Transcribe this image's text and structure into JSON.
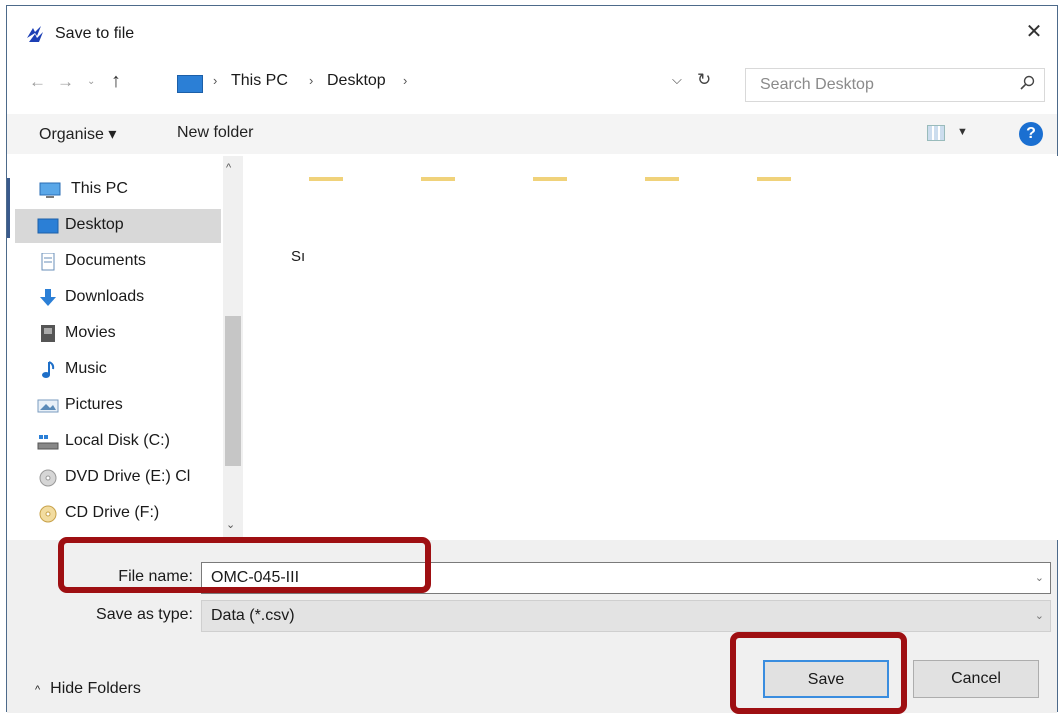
{
  "window": {
    "title": "Save to file",
    "close_symbol": "✕"
  },
  "nav": {
    "back": "←",
    "forward": "→",
    "recent": "⌄",
    "up": "↑"
  },
  "address": {
    "sep": "›",
    "crumbs": [
      "This PC",
      "Desktop"
    ],
    "dropdown": "⌵",
    "refresh": "↻"
  },
  "search": {
    "placeholder": "Search Desktop"
  },
  "toolbar": {
    "organise": "Organise ▾",
    "new_folder": "New folder",
    "view_dd": "▼",
    "help": "?"
  },
  "sidebar": {
    "items": [
      {
        "label": "This PC",
        "icon": "pc-icon"
      },
      {
        "label": "Desktop",
        "icon": "desktop-icon",
        "selected": true
      },
      {
        "label": "Documents",
        "icon": "documents-icon"
      },
      {
        "label": "Downloads",
        "icon": "downloads-icon"
      },
      {
        "label": "Movies",
        "icon": "movies-icon"
      },
      {
        "label": "Music",
        "icon": "music-icon"
      },
      {
        "label": "Pictures",
        "icon": "pictures-icon"
      },
      {
        "label": "Local Disk (C:)",
        "icon": "local-disk-icon"
      },
      {
        "label": "DVD Drive (E:) Cl",
        "icon": "dvd-drive-icon"
      },
      {
        "label": "CD Drive (F:)",
        "icon": "cd-drive-icon"
      }
    ],
    "scroll_up": "^",
    "scroll_down": "⌄"
  },
  "file_pane": {
    "label_fragment": "Sı"
  },
  "form": {
    "filename_label": "File name:",
    "filename_value": "OMC-045-III",
    "type_label": "Save as type:",
    "type_value": "Data (*.csv)",
    "dd": "⌄"
  },
  "footer": {
    "hide_caret": "^",
    "hide_folders": "Hide Folders",
    "save": "Save",
    "cancel": "Cancel"
  },
  "colors": {
    "highlight": "#9e0f12",
    "accent": "#1a6fd1"
  }
}
